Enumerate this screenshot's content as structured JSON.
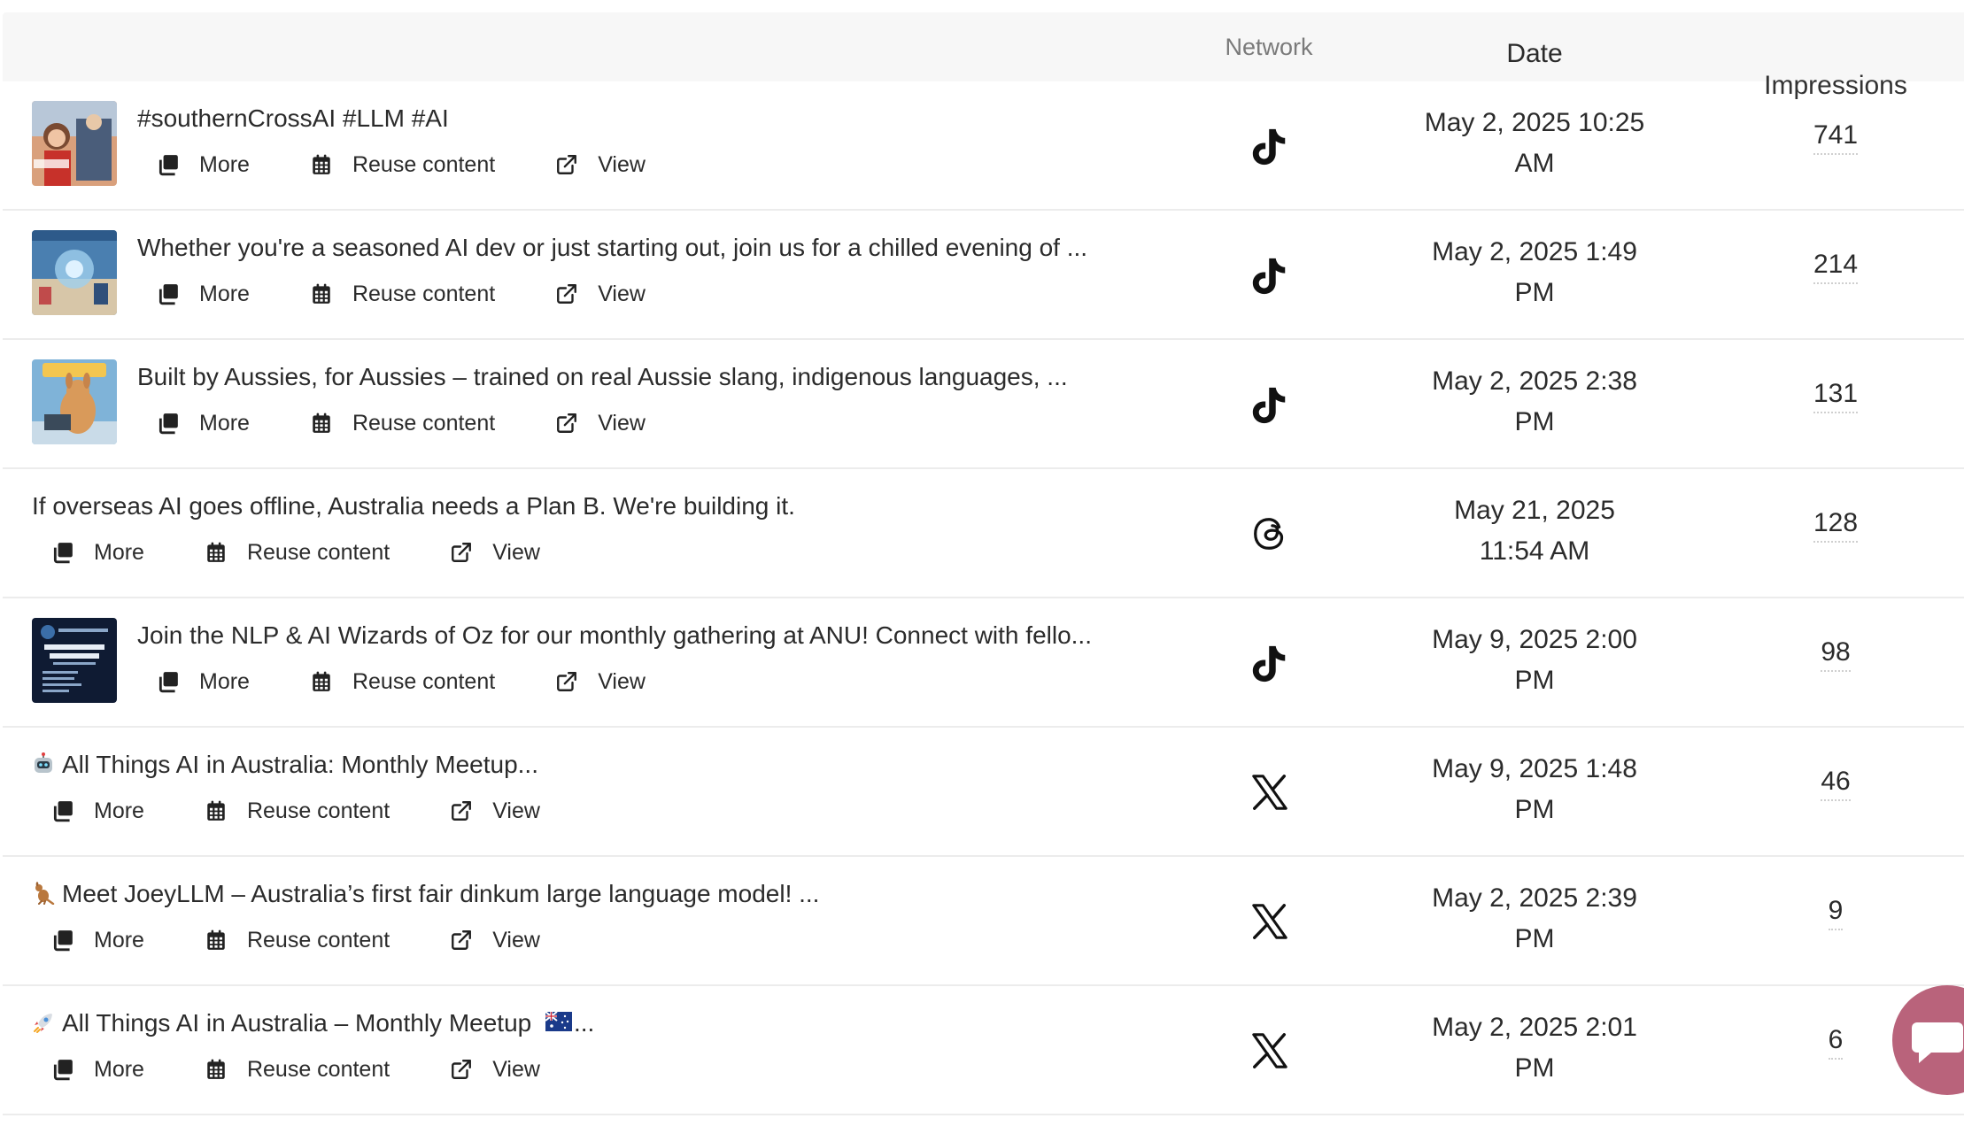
{
  "header": {
    "network": "Network",
    "date": "Date",
    "impressions": "Impressions"
  },
  "actions": {
    "more": "More",
    "reuse": "Reuse content",
    "view": "View"
  },
  "rows": [
    {
      "title": "#southernCrossAI #LLM #AI",
      "network": "tiktok",
      "date_line1": "May 2, 2025 10:25",
      "date_line2": "AM",
      "impressions": "741"
    },
    {
      "title": "Whether you're a seasoned AI dev or just starting out, join us for a chilled evening of ...",
      "network": "tiktok",
      "date_line1": "May 2, 2025 1:49",
      "date_line2": "PM",
      "impressions": "214"
    },
    {
      "title": "Built by Aussies, for Aussies – trained on real Aussie slang, indigenous languages, ...",
      "network": "tiktok",
      "date_line1": "May 2, 2025 2:38",
      "date_line2": "PM",
      "impressions": "131"
    },
    {
      "title": "If overseas AI goes offline, Australia needs a Plan B. We're building it.",
      "network": "threads",
      "date_line1": "May 21, 2025",
      "date_line2": "11:54 AM",
      "impressions": "128"
    },
    {
      "title": "Join the NLP & AI Wizards of Oz for our monthly gathering at ANU! Connect with fello...",
      "network": "tiktok",
      "date_line1": "May 9, 2025 2:00",
      "date_line2": "PM",
      "impressions": "98"
    },
    {
      "title": "All Things AI in Australia: Monthly Meetup...",
      "network": "x",
      "date_line1": "May 9, 2025 1:48",
      "date_line2": "PM",
      "impressions": "46"
    },
    {
      "title": "Meet JoeyLLM – Australia’s first fair dinkum large language model! ...",
      "network": "x",
      "date_line1": "May 2, 2025 2:39",
      "date_line2": "PM",
      "impressions": "9"
    },
    {
      "title": "All Things AI in Australia – Monthly Meetup",
      "title_suffix": "...",
      "network": "x",
      "date_line1": "May 2, 2025 2:01",
      "date_line2": "PM",
      "impressions": "6"
    }
  ],
  "colors": {
    "header_bg": "#f7f7f7",
    "chat_bubble": "#b9637b"
  }
}
